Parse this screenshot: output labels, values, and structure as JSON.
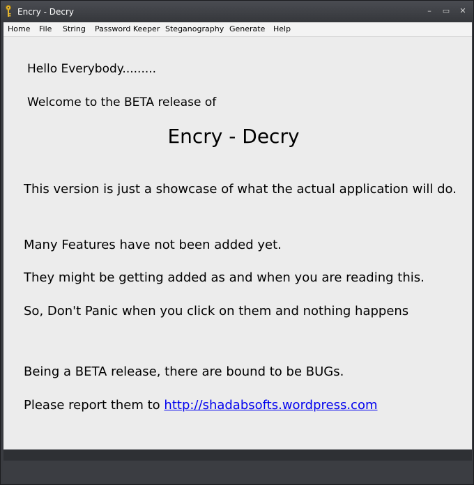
{
  "window": {
    "title": "Encry - Decry",
    "controls": {
      "minimize": "–",
      "maximize": "▭",
      "close": "✕"
    }
  },
  "menu": [
    "Home",
    "File",
    "String",
    "Password Keeper",
    "Steganography",
    "Generate",
    "Help"
  ],
  "content": {
    "greeting": "Hello Everybody.........",
    "welcome": "Welcome to the BETA release of",
    "app_name": "Encry - Decry",
    "line1": "This version is just a showcase of what the actual application will do.",
    "line2": "Many Features have not been added yet.",
    "line3": "They might be getting added as and when you are reading this.",
    "line4": "So, Don't Panic when you click on them and nothing happens",
    "line5": "Being a BETA release, there are bound to be BUGs.",
    "line6_prefix": "Please report them to ",
    "link": "http://shadabsofts.wordpress.com"
  },
  "colors": {
    "link": "#0000ee",
    "content_bg": "#ececec",
    "frame": "#3a3c41"
  }
}
